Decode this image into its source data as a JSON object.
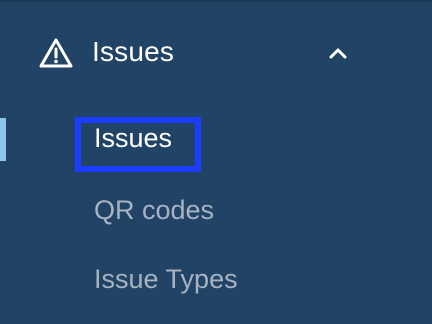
{
  "sidebar": {
    "section": {
      "title": "Issues",
      "icon": "warning-triangle-icon",
      "expanded": true,
      "chevron_icon": "chevron-up-icon"
    },
    "items": [
      {
        "label": "Issues",
        "active": true,
        "highlighted": true
      },
      {
        "label": "QR codes",
        "active": false
      },
      {
        "label": "Issue Types",
        "active": false
      }
    ]
  },
  "colors": {
    "background": "#214366",
    "active_indicator": "#8fc6ea",
    "active_text": "#ffffff",
    "inactive_text": "#a7b3c1",
    "highlight_box": "#1a3dff"
  }
}
